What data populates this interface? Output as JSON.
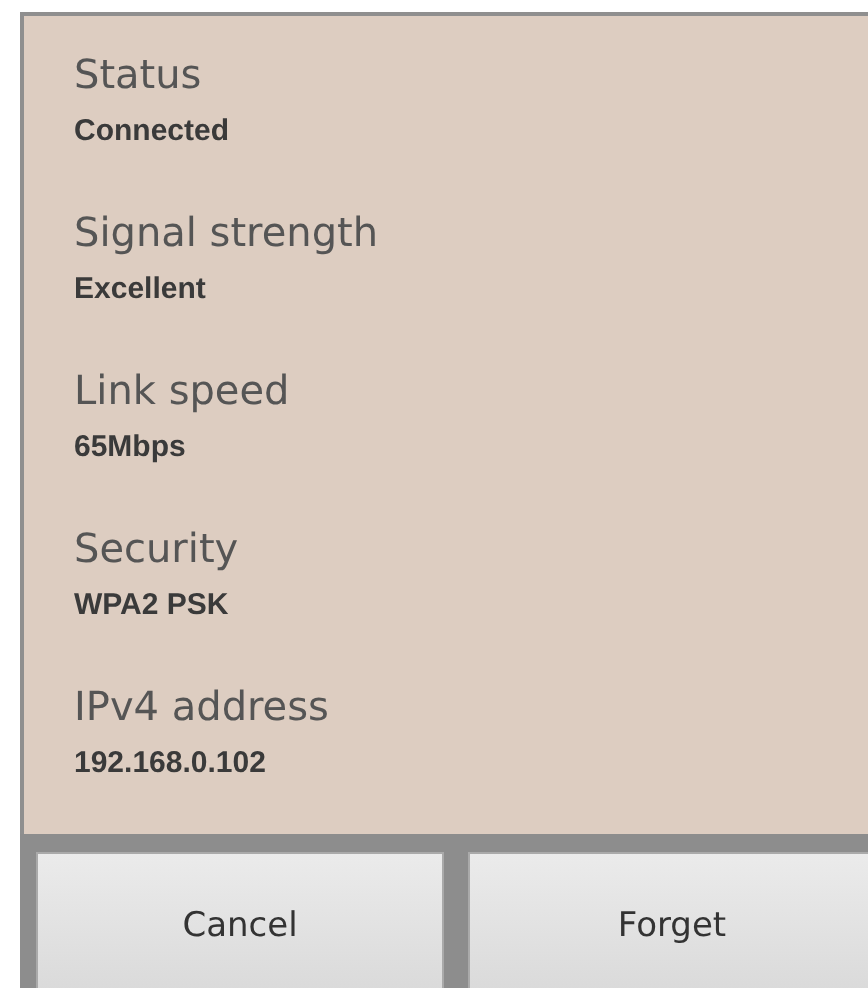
{
  "fields": [
    {
      "label": "Status",
      "value": "Connected"
    },
    {
      "label": "Signal strength",
      "value": "Excellent"
    },
    {
      "label": "Link speed",
      "value": "65Mbps"
    },
    {
      "label": "Security",
      "value": "WPA2 PSK"
    },
    {
      "label": "IPv4 address",
      "value": "192.168.0.102"
    }
  ],
  "buttons": [
    "Cancel",
    "Forget"
  ]
}
